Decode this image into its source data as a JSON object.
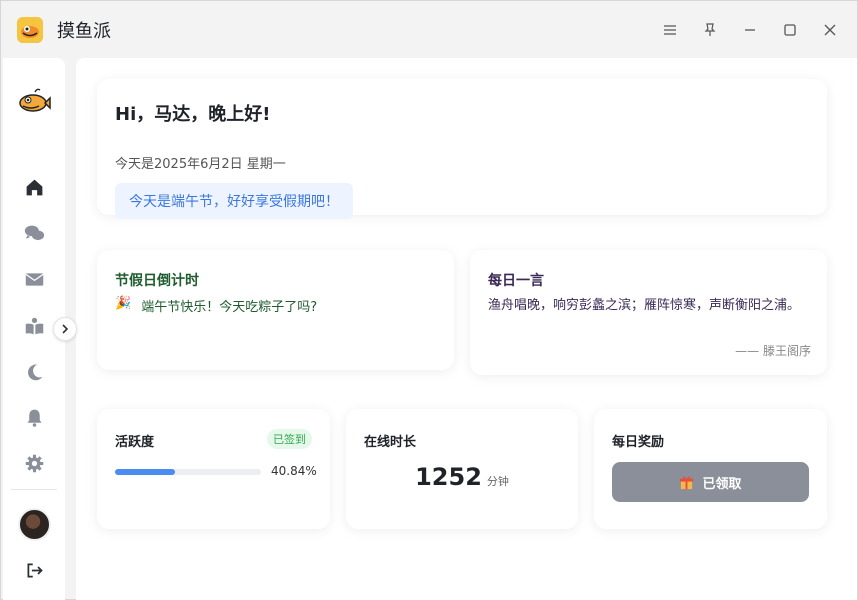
{
  "app": {
    "title": "摸鱼派"
  },
  "sidebar": {
    "items": [
      {
        "name": "home",
        "icon": "home-icon",
        "active": true
      },
      {
        "name": "chat",
        "icon": "chat-icon"
      },
      {
        "name": "mail",
        "icon": "mail-icon"
      },
      {
        "name": "reading",
        "icon": "book-icon"
      },
      {
        "name": "theme",
        "icon": "moon-icon"
      },
      {
        "name": "notifications",
        "icon": "bell-icon"
      },
      {
        "name": "settings",
        "icon": "gear-icon"
      }
    ]
  },
  "greeting": {
    "title": "Hi，马达，晚上好!",
    "date": "今天是2025年6月2日 星期一",
    "tip": "今天是端午节，好好享受假期吧！"
  },
  "holiday": {
    "title": "节假日倒计时",
    "emoji": "🎉",
    "text": "端午节快乐！今天吃粽子了吗?"
  },
  "quote": {
    "title": "每日一言",
    "text": "渔舟唱晚，响穷彭蠡之滨；雁阵惊寒，声断衡阳之浦。",
    "source": "—— 滕王阁序"
  },
  "activity": {
    "title": "活跃度",
    "badge": "已签到",
    "progress": 40.84,
    "progress_label": "40.84%"
  },
  "online": {
    "title": "在线时长",
    "value": "1252",
    "unit": "分钟"
  },
  "reward": {
    "title": "每日奖励",
    "button_label": "已领取",
    "button_icon": "gift-icon"
  },
  "colors": {
    "accent": "#4a8cf0",
    "tip_bg": "#eef4ff",
    "holiday_text": "#1f5c2e",
    "quote_text": "#3b2a55",
    "claimed_button": "#8a8f99"
  }
}
